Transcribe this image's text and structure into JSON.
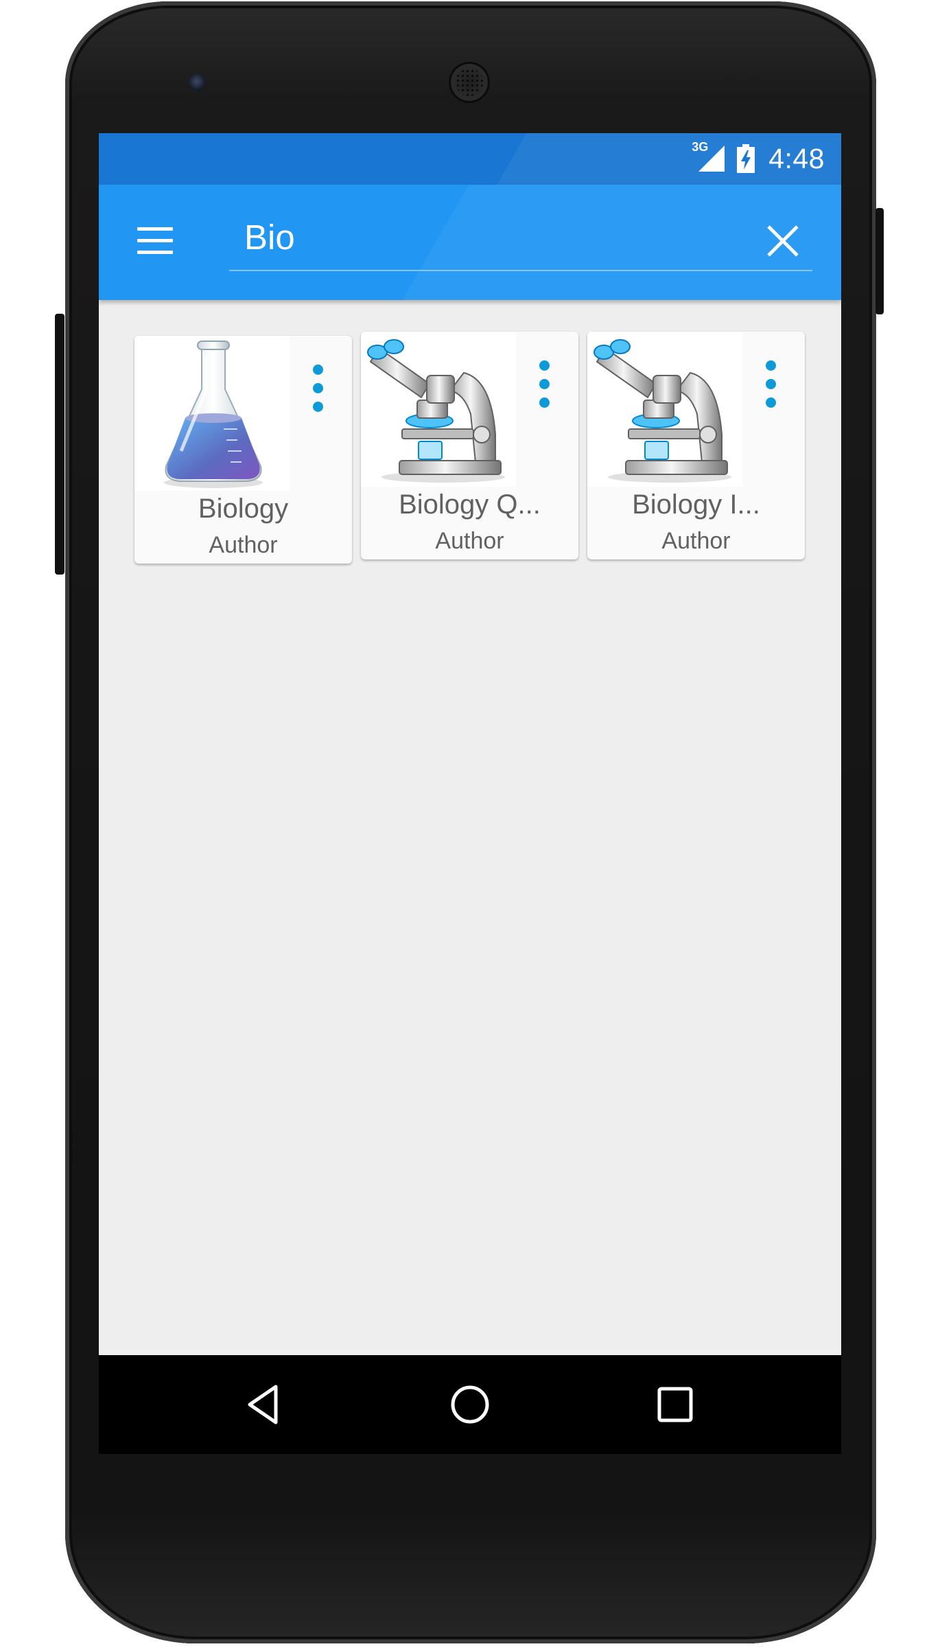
{
  "status_bar": {
    "network": "3G",
    "time": "4:48"
  },
  "toolbar": {
    "menu_icon": "hamburger-menu-icon",
    "search_value": "Bio",
    "close_icon": "close-icon"
  },
  "results": [
    {
      "title": "Biology",
      "author": "Author",
      "thumbnail": "flask-icon"
    },
    {
      "title": "Biology Q...",
      "author": "Author",
      "thumbnail": "microscope-icon"
    },
    {
      "title": "Biology I...",
      "author": "Author",
      "thumbnail": "microscope-icon"
    }
  ],
  "navigation_bar": {
    "back_icon": "back-triangle-icon",
    "home_icon": "home-circle-icon",
    "recents_icon": "recents-square-icon"
  },
  "colors": {
    "status_bar": "#1976d2",
    "toolbar": "#2196f3",
    "content_background": "#eeeeee",
    "overflow_dots": "#0e9ad7",
    "card_text": "#616161"
  }
}
